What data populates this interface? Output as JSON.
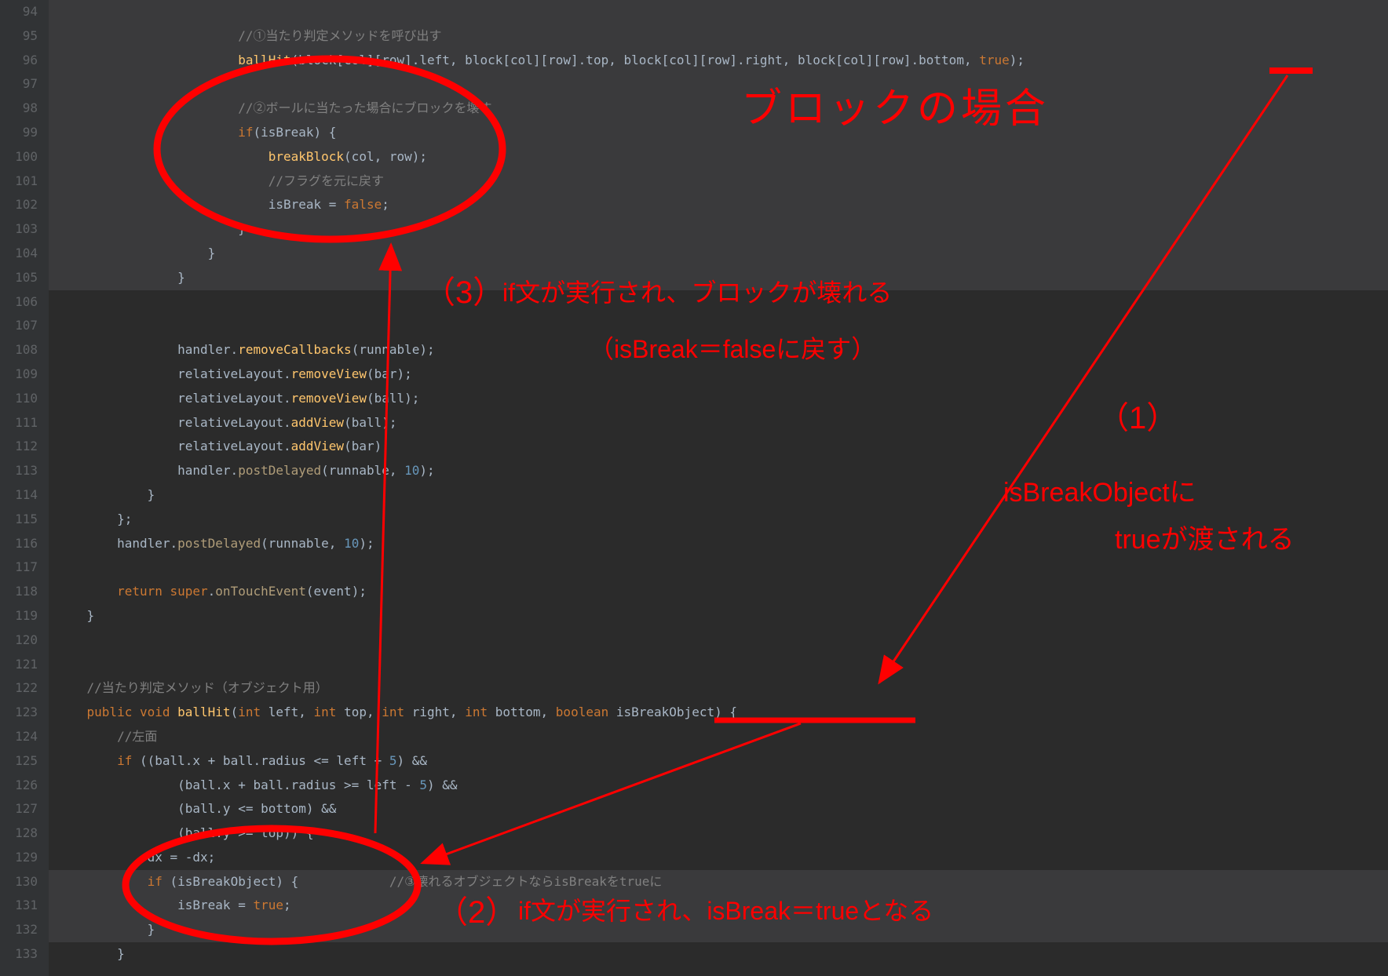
{
  "gutter": {
    "start": 94,
    "end": 133
  },
  "lines": [
    {
      "n": 94,
      "bg": "light",
      "tokens": []
    },
    {
      "n": 95,
      "bg": "light",
      "tokens": [
        {
          "t": "                        ",
          "c": ""
        },
        {
          "t": "//①当たり判定メソッドを呼び出す",
          "c": "c-comment"
        }
      ]
    },
    {
      "n": 96,
      "bg": "light",
      "tokens": [
        {
          "t": "                        ",
          "c": ""
        },
        {
          "t": "ballHit",
          "c": "c-fn"
        },
        {
          "t": "(block[col][row].left, block[col][row].top, block[col][row].right, block[col][row].bottom, ",
          "c": "c-id"
        },
        {
          "t": "true",
          "c": "c-key"
        },
        {
          "t": ");",
          "c": "c-id"
        }
      ]
    },
    {
      "n": 97,
      "bg": "light",
      "tokens": []
    },
    {
      "n": 98,
      "bg": "light",
      "tokens": [
        {
          "t": "                        ",
          "c": ""
        },
        {
          "t": "//②ボールに当たった場合にブロックを壊す",
          "c": "c-comment"
        }
      ]
    },
    {
      "n": 99,
      "bg": "light",
      "tokens": [
        {
          "t": "                        ",
          "c": ""
        },
        {
          "t": "if",
          "c": "c-key"
        },
        {
          "t": "(isBreak) {",
          "c": "c-id"
        }
      ]
    },
    {
      "n": 100,
      "bg": "light",
      "tokens": [
        {
          "t": "                            ",
          "c": ""
        },
        {
          "t": "breakBlock",
          "c": "c-fn"
        },
        {
          "t": "(col, row);",
          "c": "c-id"
        }
      ]
    },
    {
      "n": 101,
      "bg": "light",
      "tokens": [
        {
          "t": "                            ",
          "c": ""
        },
        {
          "t": "//フラグを元に戻す",
          "c": "c-comment"
        }
      ]
    },
    {
      "n": 102,
      "bg": "light",
      "tokens": [
        {
          "t": "                            isBreak = ",
          "c": "c-id"
        },
        {
          "t": "false",
          "c": "c-key"
        },
        {
          "t": ";",
          "c": "c-id"
        }
      ]
    },
    {
      "n": 103,
      "bg": "light",
      "tokens": [
        {
          "t": "                        }",
          "c": "c-id"
        }
      ]
    },
    {
      "n": 104,
      "bg": "light",
      "tokens": [
        {
          "t": "                    }",
          "c": "c-id"
        }
      ]
    },
    {
      "n": 105,
      "bg": "light",
      "tokens": [
        {
          "t": "                }",
          "c": "c-id"
        }
      ]
    },
    {
      "n": 106,
      "bg": "dark",
      "tokens": []
    },
    {
      "n": 107,
      "bg": "dark",
      "tokens": []
    },
    {
      "n": 108,
      "bg": "dark",
      "tokens": [
        {
          "t": "                handler.",
          "c": "c-id"
        },
        {
          "t": "removeCallbacks",
          "c": "c-fn"
        },
        {
          "t": "(runnable);",
          "c": "c-id"
        }
      ]
    },
    {
      "n": 109,
      "bg": "dark",
      "tokens": [
        {
          "t": "                relativeLayout.",
          "c": "c-id"
        },
        {
          "t": "removeView",
          "c": "c-fn"
        },
        {
          "t": "(bar);",
          "c": "c-id"
        }
      ]
    },
    {
      "n": 110,
      "bg": "dark",
      "tokens": [
        {
          "t": "                relativeLayout.",
          "c": "c-id"
        },
        {
          "t": "removeView",
          "c": "c-fn"
        },
        {
          "t": "(ball);",
          "c": "c-id"
        }
      ]
    },
    {
      "n": 111,
      "bg": "dark",
      "tokens": [
        {
          "t": "                relativeLayout.",
          "c": "c-id"
        },
        {
          "t": "addView",
          "c": "c-fn"
        },
        {
          "t": "(ball);",
          "c": "c-id"
        }
      ]
    },
    {
      "n": 112,
      "bg": "dark",
      "tokens": [
        {
          "t": "                relativeLayout.",
          "c": "c-id"
        },
        {
          "t": "addView",
          "c": "c-fn"
        },
        {
          "t": "(bar);",
          "c": "c-id"
        }
      ]
    },
    {
      "n": 113,
      "bg": "dark",
      "tokens": [
        {
          "t": "                handler.",
          "c": "c-id"
        },
        {
          "t": "postDelayed",
          "c": "c-call"
        },
        {
          "t": "(runnable, ",
          "c": "c-id"
        },
        {
          "t": "10",
          "c": "c-num"
        },
        {
          "t": ");",
          "c": "c-id"
        }
      ]
    },
    {
      "n": 114,
      "bg": "dark",
      "tokens": [
        {
          "t": "            }",
          "c": "c-id"
        }
      ]
    },
    {
      "n": 115,
      "bg": "dark",
      "tokens": [
        {
          "t": "        };",
          "c": "c-id"
        }
      ]
    },
    {
      "n": 116,
      "bg": "dark",
      "tokens": [
        {
          "t": "        handler.",
          "c": "c-id"
        },
        {
          "t": "postDelayed",
          "c": "c-call"
        },
        {
          "t": "(runnable, ",
          "c": "c-id"
        },
        {
          "t": "10",
          "c": "c-num"
        },
        {
          "t": ");",
          "c": "c-id"
        }
      ]
    },
    {
      "n": 117,
      "bg": "dark",
      "tokens": []
    },
    {
      "n": 118,
      "bg": "dark",
      "tokens": [
        {
          "t": "        ",
          "c": ""
        },
        {
          "t": "return super",
          "c": "c-key"
        },
        {
          "t": ".",
          "c": "c-id"
        },
        {
          "t": "onTouchEvent",
          "c": "c-call"
        },
        {
          "t": "(event);",
          "c": "c-id"
        }
      ]
    },
    {
      "n": 119,
      "bg": "dark",
      "tokens": [
        {
          "t": "    }",
          "c": "c-id"
        }
      ]
    },
    {
      "n": 120,
      "bg": "dark",
      "tokens": []
    },
    {
      "n": 121,
      "bg": "dark",
      "tokens": []
    },
    {
      "n": 122,
      "bg": "dark",
      "tokens": [
        {
          "t": "    ",
          "c": ""
        },
        {
          "t": "//当たり判定メソッド（オブジェクト用）",
          "c": "c-comment"
        }
      ]
    },
    {
      "n": 123,
      "bg": "dark",
      "tokens": [
        {
          "t": "    ",
          "c": ""
        },
        {
          "t": "public void ",
          "c": "c-key"
        },
        {
          "t": "ballHit",
          "c": "c-fn"
        },
        {
          "t": "(",
          "c": "c-id"
        },
        {
          "t": "int ",
          "c": "c-key"
        },
        {
          "t": "left, ",
          "c": "c-id"
        },
        {
          "t": "int ",
          "c": "c-key"
        },
        {
          "t": "top, ",
          "c": "c-id"
        },
        {
          "t": "int ",
          "c": "c-key"
        },
        {
          "t": "right, ",
          "c": "c-id"
        },
        {
          "t": "int ",
          "c": "c-key"
        },
        {
          "t": "bottom, ",
          "c": "c-id"
        },
        {
          "t": "boolean ",
          "c": "c-key"
        },
        {
          "t": "isBreakObject) {",
          "c": "c-id"
        }
      ]
    },
    {
      "n": 124,
      "bg": "dark",
      "tokens": [
        {
          "t": "        ",
          "c": ""
        },
        {
          "t": "//左面",
          "c": "c-comment"
        }
      ]
    },
    {
      "n": 125,
      "bg": "dark",
      "tokens": [
        {
          "t": "        ",
          "c": ""
        },
        {
          "t": "if ",
          "c": "c-key"
        },
        {
          "t": "((ball.x + ball.radius <= left + ",
          "c": "c-id"
        },
        {
          "t": "5",
          "c": "c-num"
        },
        {
          "t": ") &&",
          "c": "c-id"
        }
      ]
    },
    {
      "n": 126,
      "bg": "dark",
      "tokens": [
        {
          "t": "                (ball.x + ball.radius >= left - ",
          "c": "c-id"
        },
        {
          "t": "5",
          "c": "c-num"
        },
        {
          "t": ") &&",
          "c": "c-id"
        }
      ]
    },
    {
      "n": 127,
      "bg": "dark",
      "tokens": [
        {
          "t": "                (ball.y <= bottom) &&",
          "c": "c-id"
        }
      ]
    },
    {
      "n": 128,
      "bg": "dark",
      "tokens": [
        {
          "t": "                (ball.y >= top)) {",
          "c": "c-id"
        }
      ]
    },
    {
      "n": 129,
      "bg": "dark",
      "tokens": [
        {
          "t": "            dx = -dx;",
          "c": "c-id"
        }
      ]
    },
    {
      "n": 130,
      "bg": "light",
      "tokens": [
        {
          "t": "            ",
          "c": ""
        },
        {
          "t": "if ",
          "c": "c-key"
        },
        {
          "t": "(isBreakObject) {            ",
          "c": "c-id"
        },
        {
          "t": "//③壊れるオブジェクトならisBreakをtrueに",
          "c": "c-comment"
        }
      ]
    },
    {
      "n": 131,
      "bg": "light",
      "tokens": [
        {
          "t": "                isBreak = ",
          "c": "c-id"
        },
        {
          "t": "true",
          "c": "c-key"
        },
        {
          "t": ";",
          "c": "c-id"
        }
      ]
    },
    {
      "n": 132,
      "bg": "light",
      "tokens": [
        {
          "t": "            }",
          "c": "c-id"
        }
      ]
    },
    {
      "n": 133,
      "bg": "dark",
      "tokens": [
        {
          "t": "        }",
          "c": "c-id"
        }
      ]
    }
  ],
  "annotations": {
    "title_block": "ブロックの場合",
    "step1_num": "（1）",
    "step1_l1": "isBreakObjectに",
    "step1_l2": "trueが渡される",
    "step2_num": "（2）",
    "step2_l1": "if文が実行され、isBreak＝trueとなる",
    "step3_num": "（3）",
    "step3_l1": "if文が実行され、ブロックが壊れる",
    "step3_l2": "（isBreak＝falseに戻す）"
  },
  "colors": {
    "anno": "#ff0000"
  }
}
